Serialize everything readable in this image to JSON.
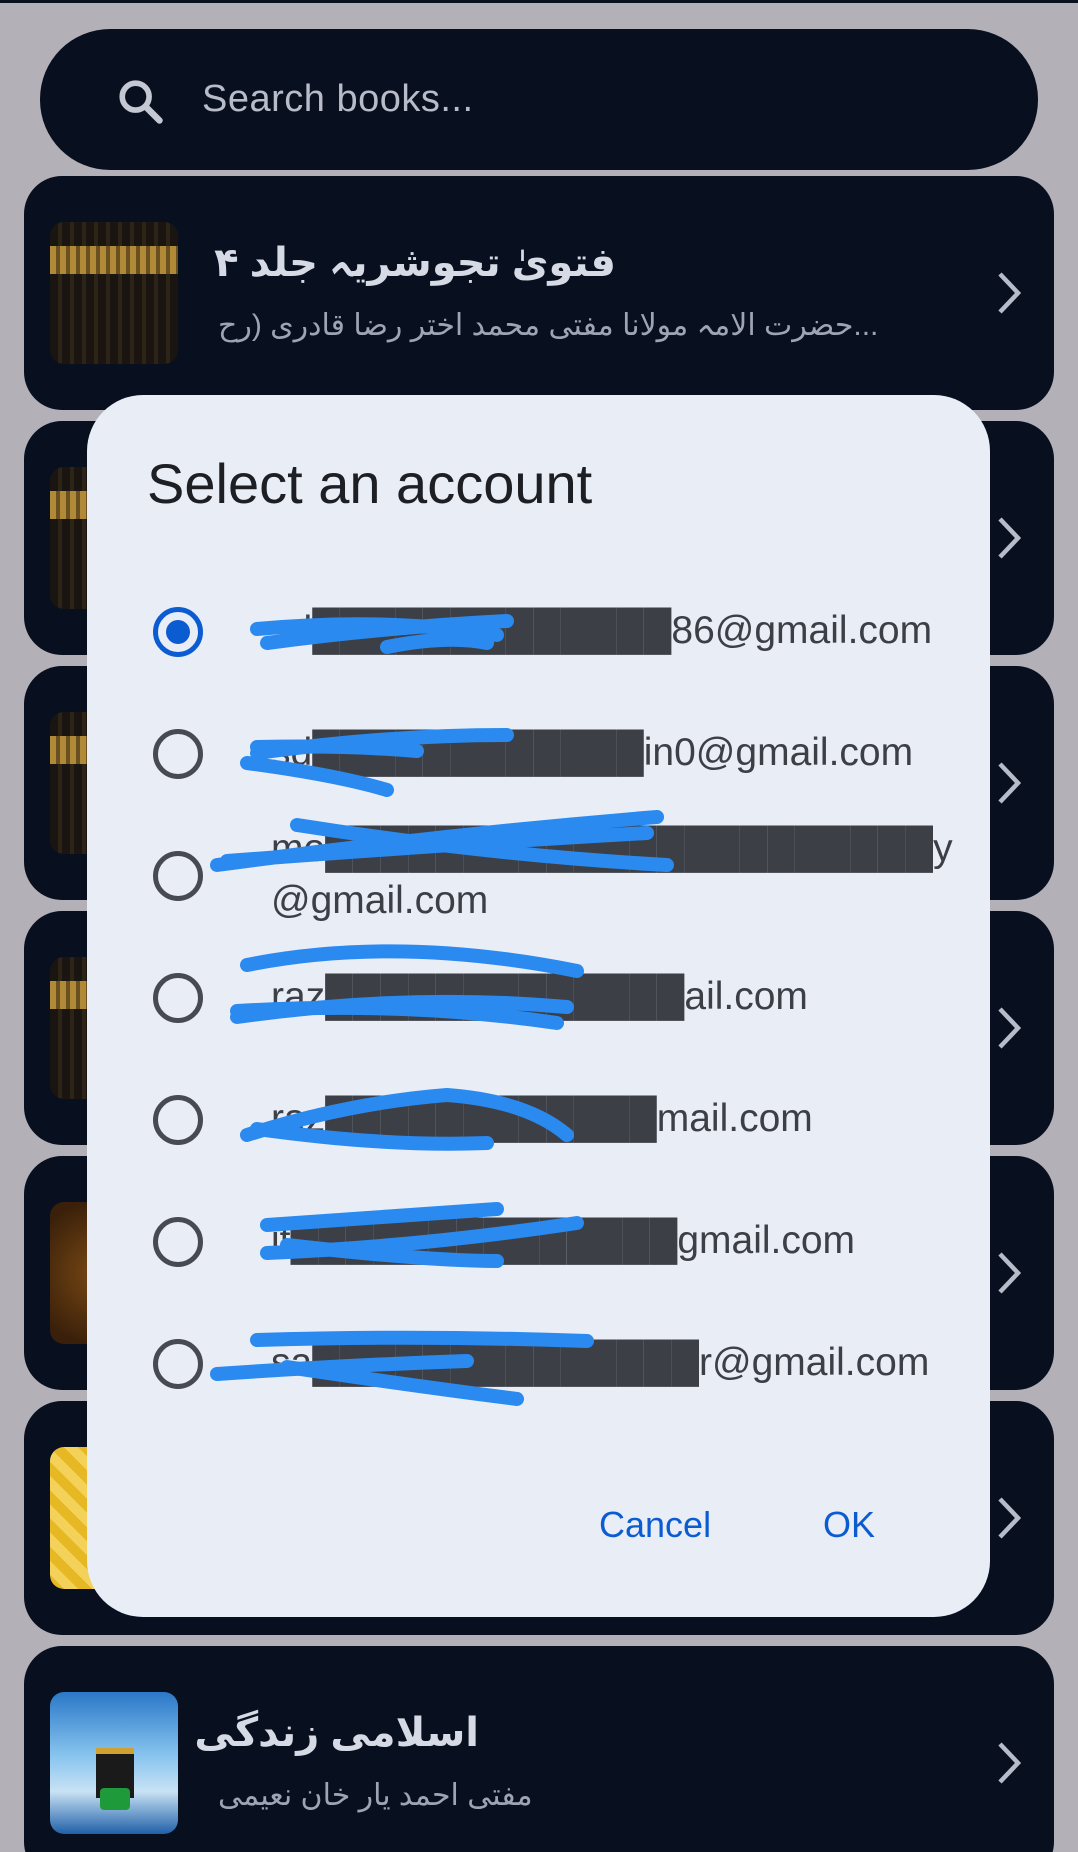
{
  "search": {
    "placeholder": "Search books...",
    "icon": "search-icon"
  },
  "books": [
    {
      "title": "فتویٰ تجوشریہ جلد ۴",
      "author": "...حضرت الامہ مولانا مفتی محمد اختر رضا قادری (رح",
      "thumb": "kaaba"
    },
    {
      "title": "",
      "author": "",
      "thumb": "kaaba"
    },
    {
      "title": "",
      "author": "",
      "thumb": "kaaba"
    },
    {
      "title": "",
      "author": "",
      "thumb": "kaaba"
    },
    {
      "title": "",
      "author": "",
      "thumb": "brown"
    },
    {
      "title": "",
      "author": "",
      "thumb": "yellow"
    },
    {
      "title": "اسلامی زندگی",
      "author": "مفتی احمد یار خان نعیمی",
      "thumb": "blue"
    }
  ],
  "dialog": {
    "title": "Select an account",
    "accounts": [
      {
        "email": "sd█████████████86@gmail.com",
        "selected": true
      },
      {
        "email": "sd████████████in0@gmail.com",
        "selected": false
      },
      {
        "email": "mo██████████████████████y@gmail.com",
        "selected": false
      },
      {
        "email": "raz█████████████ail.com",
        "selected": false
      },
      {
        "email": "raz████████████mail.com",
        "selected": false
      },
      {
        "email": "it██████████████gmail.com",
        "selected": false
      },
      {
        "email": "sa██████████████r@gmail.com",
        "selected": false
      }
    ],
    "cancel_label": "Cancel",
    "ok_label": "OK"
  },
  "colors": {
    "accent": "#0c5cd1",
    "card_bg": "#08101f",
    "dialog_bg": "#e9edf6",
    "redaction": "#2a8af0"
  }
}
